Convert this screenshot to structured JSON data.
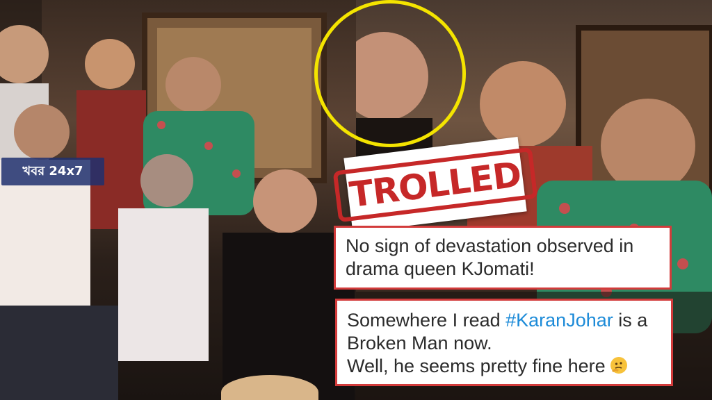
{
  "watermark": {
    "text": "খবর 24x7"
  },
  "stamp": {
    "text": "TROLLED",
    "color": "#c62828"
  },
  "highlight": {
    "color": "#f4e400"
  },
  "tweets": [
    {
      "line1": "No sign of devastation observed in",
      "line2": "drama queen KJomati!"
    },
    {
      "line1_pre": "Somewhere I read ",
      "hashtag": "#KaranJohar",
      "line1_post": " is a",
      "line2": "Broken Man now.",
      "line3": "Well, he seems pretty fine here",
      "emoji": "thinking-face-icon"
    }
  ],
  "colors": {
    "tweet_border": "#d23b3b",
    "hashtag": "#1d8bd8",
    "watermark_bg": "#20306e"
  }
}
